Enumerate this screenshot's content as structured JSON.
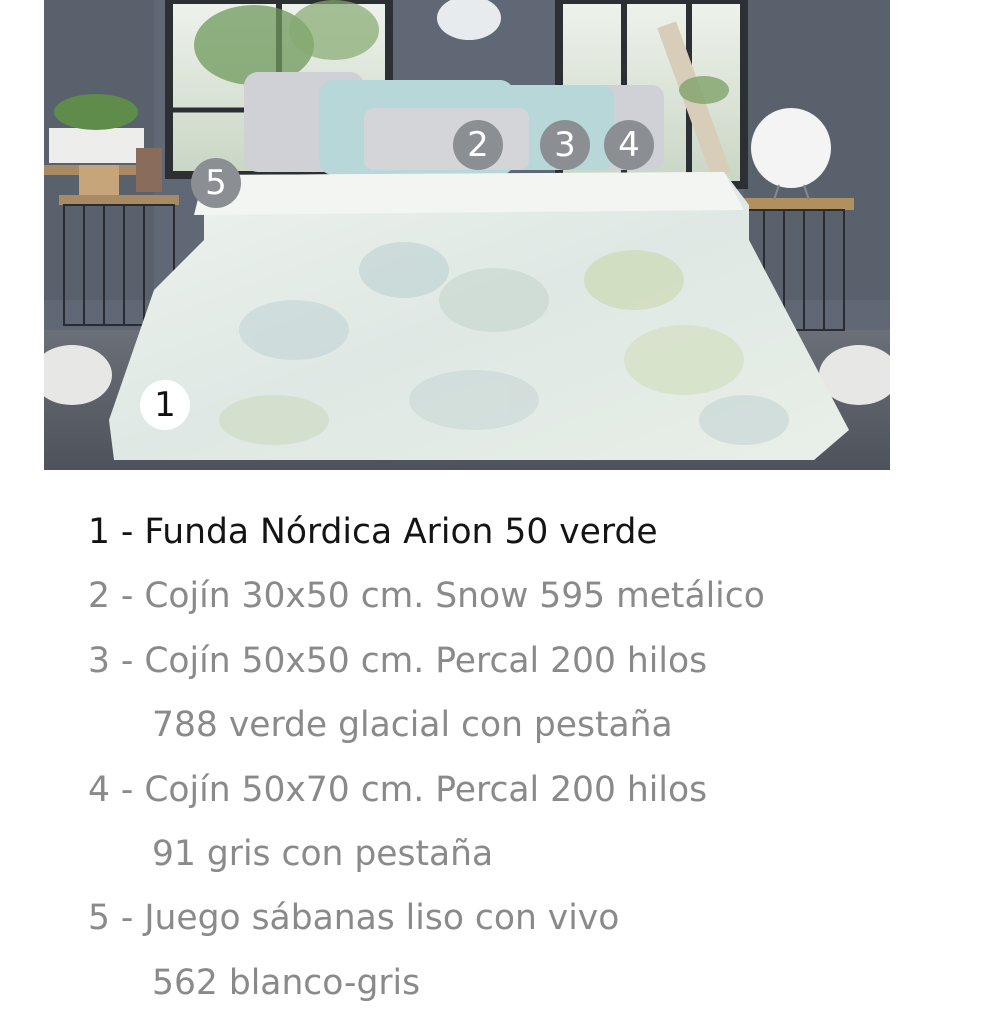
{
  "markers": [
    {
      "number": "1"
    },
    {
      "number": "2"
    },
    {
      "number": "3"
    },
    {
      "number": "4"
    },
    {
      "number": "5"
    }
  ],
  "items": [
    {
      "text": "1 - Funda Nórdica Arion 50 verde",
      "continuation": ""
    },
    {
      "text": "2 - Cojín 30x50 cm. Snow 595 metálico",
      "continuation": ""
    },
    {
      "text": "3 - Cojín 50x50 cm. Percal 200 hilos",
      "continuation": "788 verde glacial con pestaña"
    },
    {
      "text": "4 - Cojín 50x70 cm. Percal 200 hilos",
      "continuation": "91 gris con pestaña"
    },
    {
      "text": "5 - Juego sábanas liso con vivo",
      "continuation": "562 blanco-gris"
    }
  ],
  "colors": {
    "active_text": "#141414",
    "inactive_text": "#8a8a8a",
    "marker_bg": "#8b8e92",
    "marker_text": "#ffffff"
  }
}
